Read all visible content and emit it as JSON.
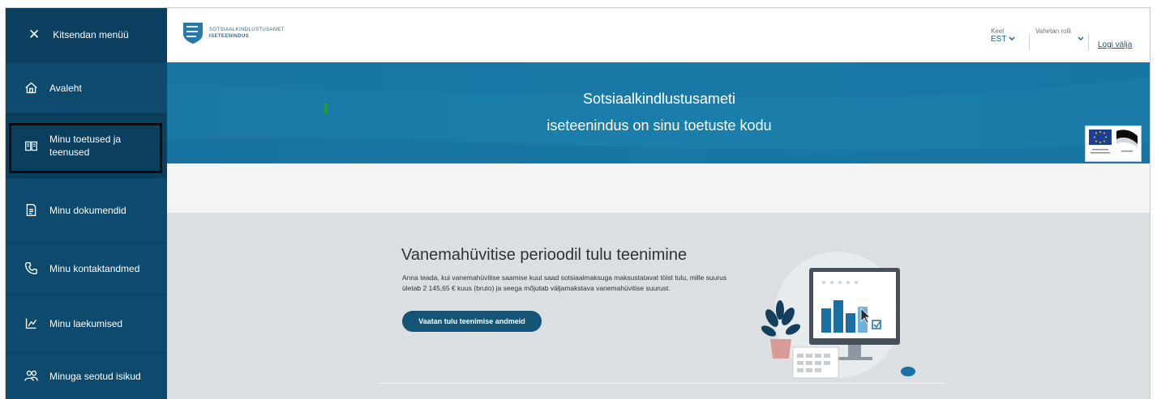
{
  "sidebar": {
    "toggle_label": "Kitsendan menüü",
    "items": [
      {
        "label": "Avaleht",
        "icon": "home-icon"
      },
      {
        "label": "Minu toetused ja teenused",
        "icon": "book-icon"
      },
      {
        "label": "Minu dokumendid",
        "icon": "document-icon"
      },
      {
        "label": "Minu kontaktandmed",
        "icon": "phone-icon"
      },
      {
        "label": "Minu laekumised",
        "icon": "receipt-icon"
      },
      {
        "label": "Minuga seotud isikud",
        "icon": "people-icon"
      }
    ]
  },
  "header": {
    "logo_text_line1": "Sotsiaalkindlustusamet",
    "logo_text_line2": "iseteenindus",
    "language_label": "Keel",
    "language_value": "EST",
    "role_label": "Vahetan rolli",
    "role_value": "",
    "logout_label": "Logi välja"
  },
  "hero": {
    "line1": "Sotsiaalkindlustusameti",
    "line2": "iseteenindus on sinu toetuste kodu"
  },
  "card": {
    "title": "Vanemahüvitise perioodil tulu teenimine",
    "text": "Anna teada, kui vanemahüvitise saamise kuul saad sotsiaalmaksuga maksustatavat töist tulu, mille suurus ületab 2 145,65 € kuus (bruto) ja seega mõjutab väljamakstava vanemahüvitise suurust.",
    "button_label": "Vaatan tulu teenimise andmeid"
  },
  "colors": {
    "sidebar": "#0e4a6d",
    "hero": "#1a7aa8",
    "button": "#165476",
    "link": "#1d5d86"
  }
}
